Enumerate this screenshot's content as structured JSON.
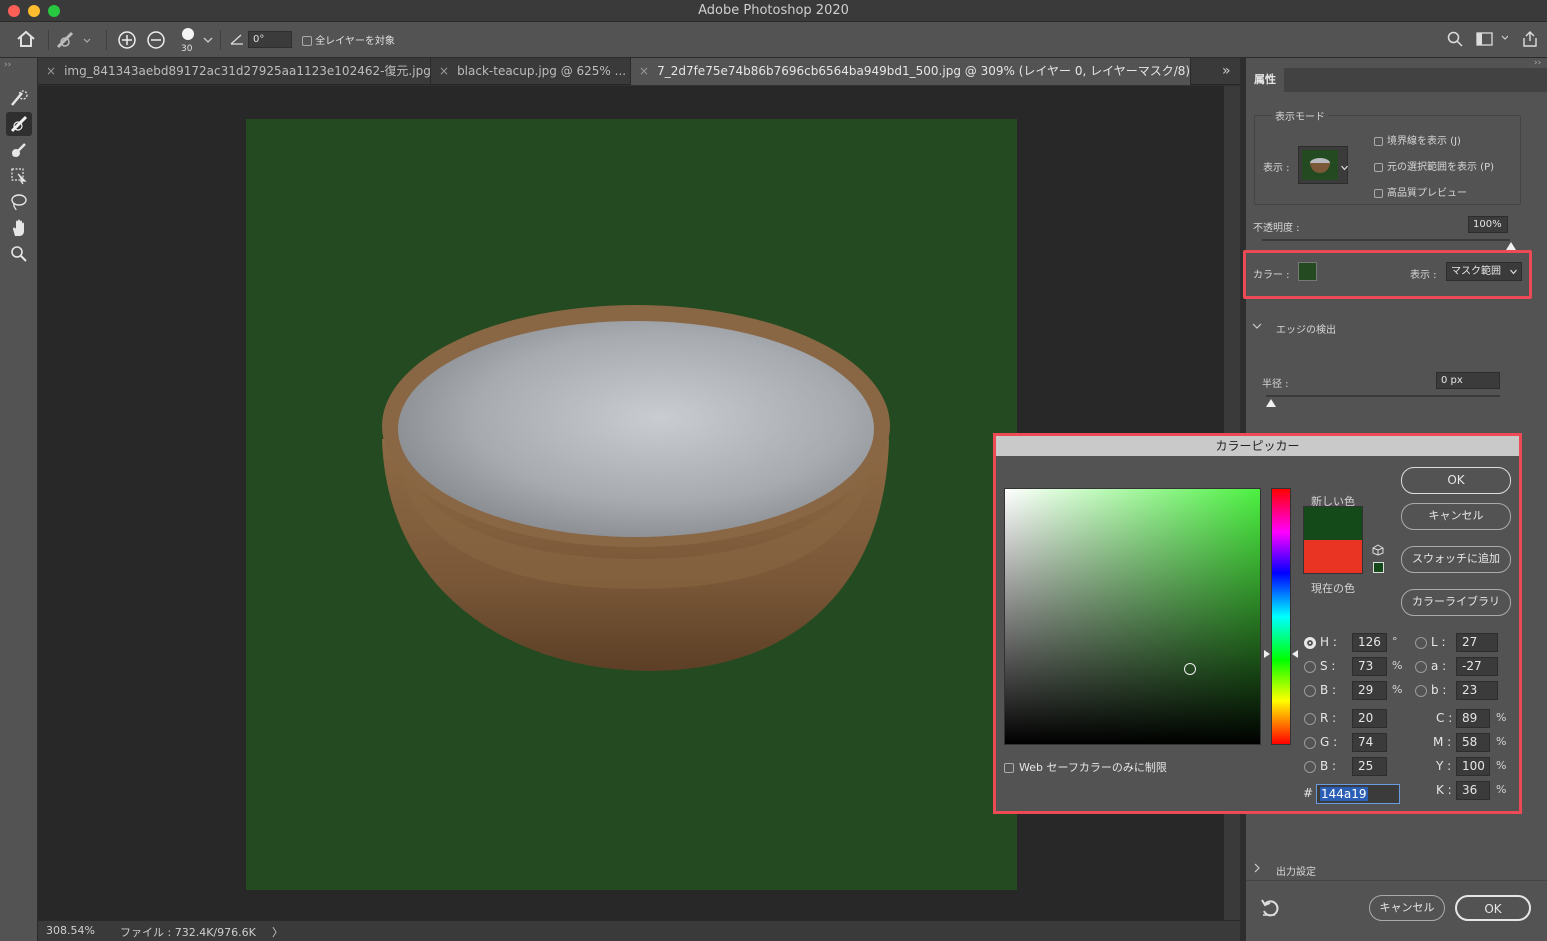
{
  "app": {
    "title": "Adobe Photoshop 2020"
  },
  "options_bar": {
    "brush_size": "30",
    "angle": "0°",
    "all_layers_label": "全レイヤーを対象"
  },
  "tabs": [
    {
      "label": "img_841343aebd89172ac31d27925aa1123e102462-復元.jpg"
    },
    {
      "label": "black-teacup.jpg @ 625% ..."
    },
    {
      "label": "7_2d7fe75e74b86b7696cb6564ba949bd1_500.jpg @ 309% (レイヤー 0, レイヤーマスク/8) *"
    }
  ],
  "tab_overflow": "»",
  "status": {
    "zoom": "308.54%",
    "file_info": "ファイル : 732.4K/976.6K",
    "arrow": "〉"
  },
  "properties": {
    "tab_label": "属性",
    "view_mode": {
      "title": "表示モード",
      "view_label": "表示 :",
      "show_edge": "境界線を表示 (J)",
      "show_original": "元の選択範囲を表示 (P)",
      "hq_preview": "高品質プレビュー"
    },
    "opacity_label": "不透明度 :",
    "opacity_value": "100%",
    "color_label": "カラー :",
    "mask_color": "#234a20",
    "display_label": "表示 :",
    "display_value": "マスク範囲",
    "edge_detection": "エッジの検出",
    "radius_label": "半径 :",
    "radius_value": "0 px",
    "output_settings": "出力設定",
    "cancel": "キャンセル",
    "ok": "OK"
  },
  "color_picker": {
    "title": "カラーピッカー",
    "new_color_label": "新しい色",
    "current_color_label": "現在の色",
    "new_color": "#144a19",
    "current_color": "#e93323",
    "ok": "OK",
    "cancel": "キャンセル",
    "add_to_swatches": "スウォッチに追加",
    "color_libraries": "カラーライブラリ",
    "web_safe_label": "Web セーフカラーのみに制限",
    "hsb": {
      "h_label": "H :",
      "h": "126",
      "h_unit": "°",
      "s_label": "S :",
      "s": "73",
      "s_unit": "%",
      "b_label": "B :",
      "b": "29",
      "b_unit": "%"
    },
    "rgb": {
      "r_label": "R :",
      "r": "20",
      "g_label": "G :",
      "g": "74",
      "b_label": "B :",
      "b": "25"
    },
    "lab": {
      "l_label": "L :",
      "l": "27",
      "a_label": "a :",
      "a": "-27",
      "b_label": "b :",
      "b": "23"
    },
    "cmyk": {
      "c_label": "C :",
      "c": "89",
      "m_label": "M :",
      "m": "58",
      "y_label": "Y :",
      "y": "100",
      "k_label": "K :",
      "k": "36",
      "unit": "%"
    },
    "hex_label": "#",
    "hex": "144a19"
  }
}
